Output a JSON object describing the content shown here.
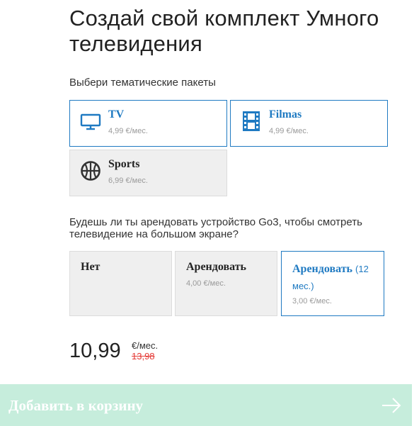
{
  "title": "Создай свой комплект Умного телевидения",
  "packages": {
    "label": "Выбери тематические пакеты",
    "items": [
      {
        "name": "TV",
        "price": "4,99 €/мес.",
        "icon": "tv-icon",
        "selected": true
      },
      {
        "name": "Filmas",
        "price": "4,99 €/мес.",
        "icon": "film-icon",
        "selected": true
      },
      {
        "name": "Sports",
        "price": "6,99 €/мес.",
        "icon": "basketball-icon",
        "selected": false
      }
    ]
  },
  "device": {
    "question": "Будешь ли ты арендовать устройство Go3, чтобы смотреть телевидение на большом экране?",
    "options": [
      {
        "name": "Нет",
        "price": "",
        "selected": false
      },
      {
        "name": "Арендовать",
        "price": "4,00 €/мес.",
        "selected": false
      },
      {
        "name": "Арендовать",
        "suffix": "(12 мес.)",
        "price": "3,00 €/мес.",
        "selected": true
      }
    ]
  },
  "total": {
    "value": "10,99",
    "unit": "€/мес.",
    "old_price": "13,98"
  },
  "cart_button": {
    "label": "Добавить в корзину",
    "icon": "arrow-right-icon"
  },
  "colors": {
    "accent": "#1f7ac2",
    "button_bg": "#c6eddc",
    "old_price": "#e53935"
  }
}
